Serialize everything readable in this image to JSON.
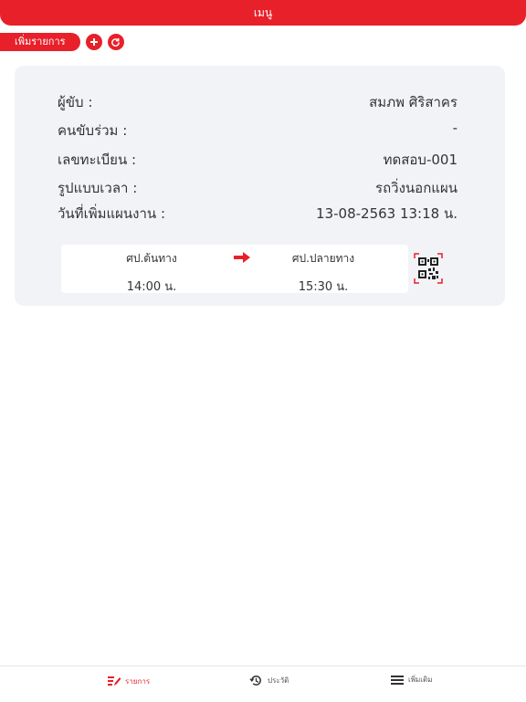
{
  "header": {
    "title": "เมนู"
  },
  "actions": {
    "add_label": "เพิ่มรายการ"
  },
  "details": [
    {
      "label": "ผู้ขับ :",
      "value": "สมภพ  ศิริสาคร"
    },
    {
      "label": "คนขับร่วม :",
      "value": "-"
    },
    {
      "label": "เลขทะเบียน :",
      "value": "ทดสอบ-001"
    },
    {
      "label": "รูปแบบเวลา :",
      "value": "รถวิ่งนอกแผน"
    },
    {
      "label": "วันที่เพิ่มแผนงาน :",
      "value": "13-08-2563 13:18 น."
    }
  ],
  "trip": {
    "origin_label": "ศป.ต้นทาง",
    "origin_time": "14:00 น.",
    "dest_label": "ศป.ปลายทาง",
    "dest_time": "15:30 น."
  },
  "tabs": [
    {
      "label": "รายการ",
      "icon": "list-edit-icon",
      "active": true
    },
    {
      "label": "ประวัติ",
      "icon": "history-icon",
      "active": false
    },
    {
      "label": "เพิ่มเติม",
      "icon": "menu-icon",
      "active": false
    }
  ],
  "colors": {
    "accent": "#e8202a",
    "card": "#f1f3f7"
  }
}
